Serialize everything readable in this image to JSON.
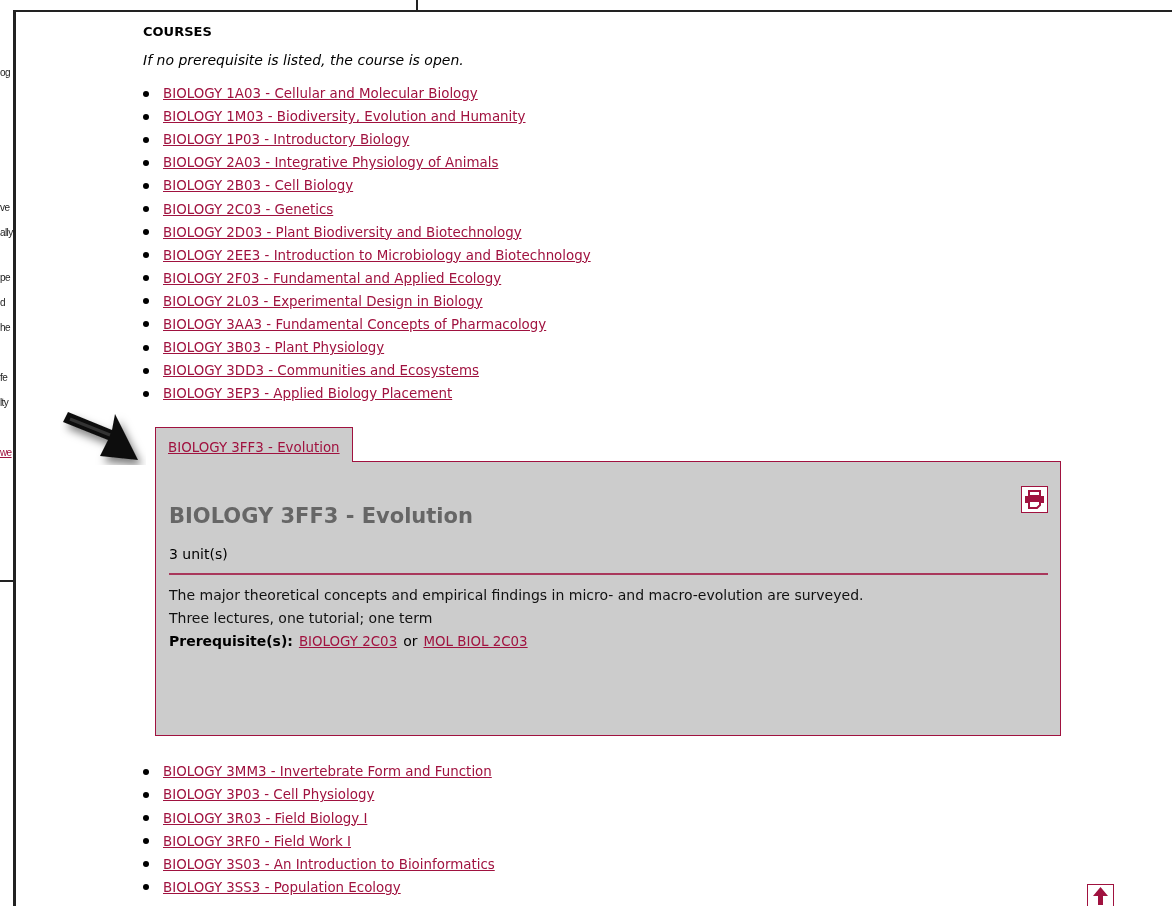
{
  "background_page": {
    "fragments": [
      {
        "text": "og",
        "kind": "text"
      },
      {
        "text": "ve",
        "kind": "text"
      },
      {
        "text": "ally",
        "kind": "text"
      },
      {
        "text": "pe",
        "kind": "text"
      },
      {
        "text": "d",
        "kind": "text"
      },
      {
        "text": "he",
        "kind": "text"
      },
      {
        "text": "fe",
        "kind": "text"
      },
      {
        "text": "lty",
        "kind": "text"
      },
      {
        "text": "we",
        "kind": "link"
      }
    ]
  },
  "heading": "COURSES",
  "note": "If no prerequisite is listed, the course is open.",
  "courses_before": [
    "BIOLOGY 1A03 - Cellular and Molecular Biology",
    "BIOLOGY 1M03 - Biodiversity, Evolution and Humanity",
    "BIOLOGY 1P03 - Introductory Biology",
    "BIOLOGY 2A03 - Integrative Physiology of Animals",
    "BIOLOGY 2B03 - Cell Biology",
    "BIOLOGY 2C03 - Genetics",
    "BIOLOGY 2D03 - Plant Biodiversity and Biotechnology",
    "BIOLOGY 2EE3 - Introduction to Microbiology and Biotechnology",
    "BIOLOGY 2F03 - Fundamental and Applied Ecology",
    "BIOLOGY 2L03 - Experimental Design in Biology",
    "BIOLOGY 3AA3 - Fundamental Concepts of Pharmacology",
    "BIOLOGY 3B03 - Plant Physiology",
    "BIOLOGY 3DD3 - Communities and Ecosystems",
    "BIOLOGY 3EP3 - Applied Biology Placement"
  ],
  "expanded_course": {
    "tab": "BIOLOGY 3FF3 - Evolution",
    "title": "BIOLOGY 3FF3 - Evolution",
    "units": "3 unit(s)",
    "description": [
      "The major theoretical concepts and empirical findings in micro- and macro-evolution are surveyed.",
      "Three lectures, one tutorial; one term"
    ],
    "prerequisite_label": "Prerequisite(s):",
    "prerequisites": [
      "BIOLOGY 2C03",
      "MOL BIOL 2C03"
    ],
    "joiner": "or"
  },
  "courses_after": [
    "BIOLOGY 3MM3 - Invertebrate Form and Function",
    "BIOLOGY 3P03 - Cell Physiology",
    "BIOLOGY 3R03 - Field Biology I",
    "BIOLOGY 3RF0 - Field Work I",
    "BIOLOGY 3S03 - An Introduction to Bioinformatics",
    "BIOLOGY 3SS3 - Population Ecology"
  ]
}
